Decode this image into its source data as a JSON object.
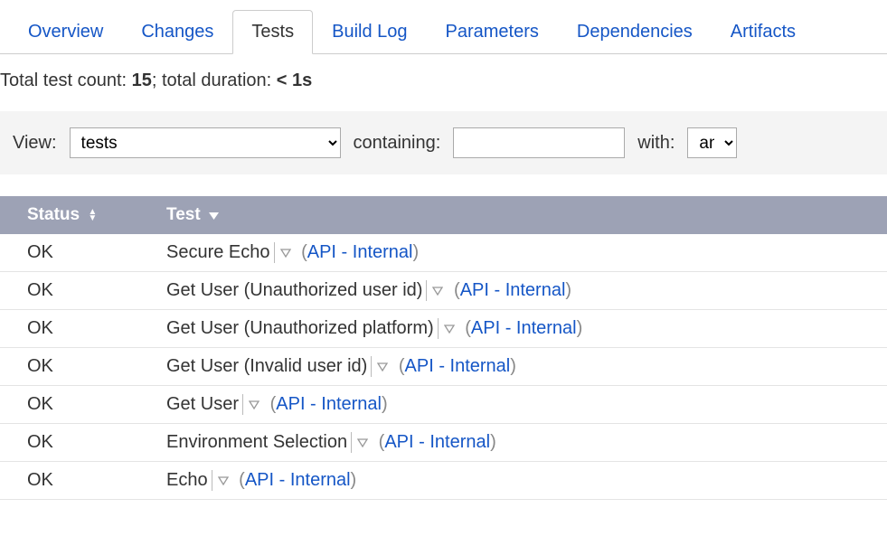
{
  "tabs": [
    {
      "label": "Overview",
      "active": false
    },
    {
      "label": "Changes",
      "active": false
    },
    {
      "label": "Tests",
      "active": true
    },
    {
      "label": "Build Log",
      "active": false
    },
    {
      "label": "Parameters",
      "active": false
    },
    {
      "label": "Dependencies",
      "active": false
    },
    {
      "label": "Artifacts",
      "active": false
    }
  ],
  "summary": {
    "prefix": "Total test count: ",
    "count": "15",
    "mid": "; total duration: ",
    "duration": "< 1s"
  },
  "filter": {
    "view_label": "View:",
    "view_value": "tests",
    "containing_label": "containing:",
    "containing_value": "",
    "with_label": "with:",
    "with_value": "any"
  },
  "columns": {
    "status": "Status",
    "test": "Test"
  },
  "rows": [
    {
      "status": "OK",
      "name": "Secure Echo",
      "suite": "API - Internal"
    },
    {
      "status": "OK",
      "name": "Get User (Unauthorized user id)",
      "suite": "API - Internal"
    },
    {
      "status": "OK",
      "name": "Get User (Unauthorized platform)",
      "suite": "API - Internal"
    },
    {
      "status": "OK",
      "name": "Get User (Invalid user id)",
      "suite": "API - Internal"
    },
    {
      "status": "OK",
      "name": "Get User",
      "suite": "API - Internal"
    },
    {
      "status": "OK",
      "name": "Environment Selection",
      "suite": "API - Internal"
    },
    {
      "status": "OK",
      "name": "Echo",
      "suite": "API - Internal"
    }
  ]
}
